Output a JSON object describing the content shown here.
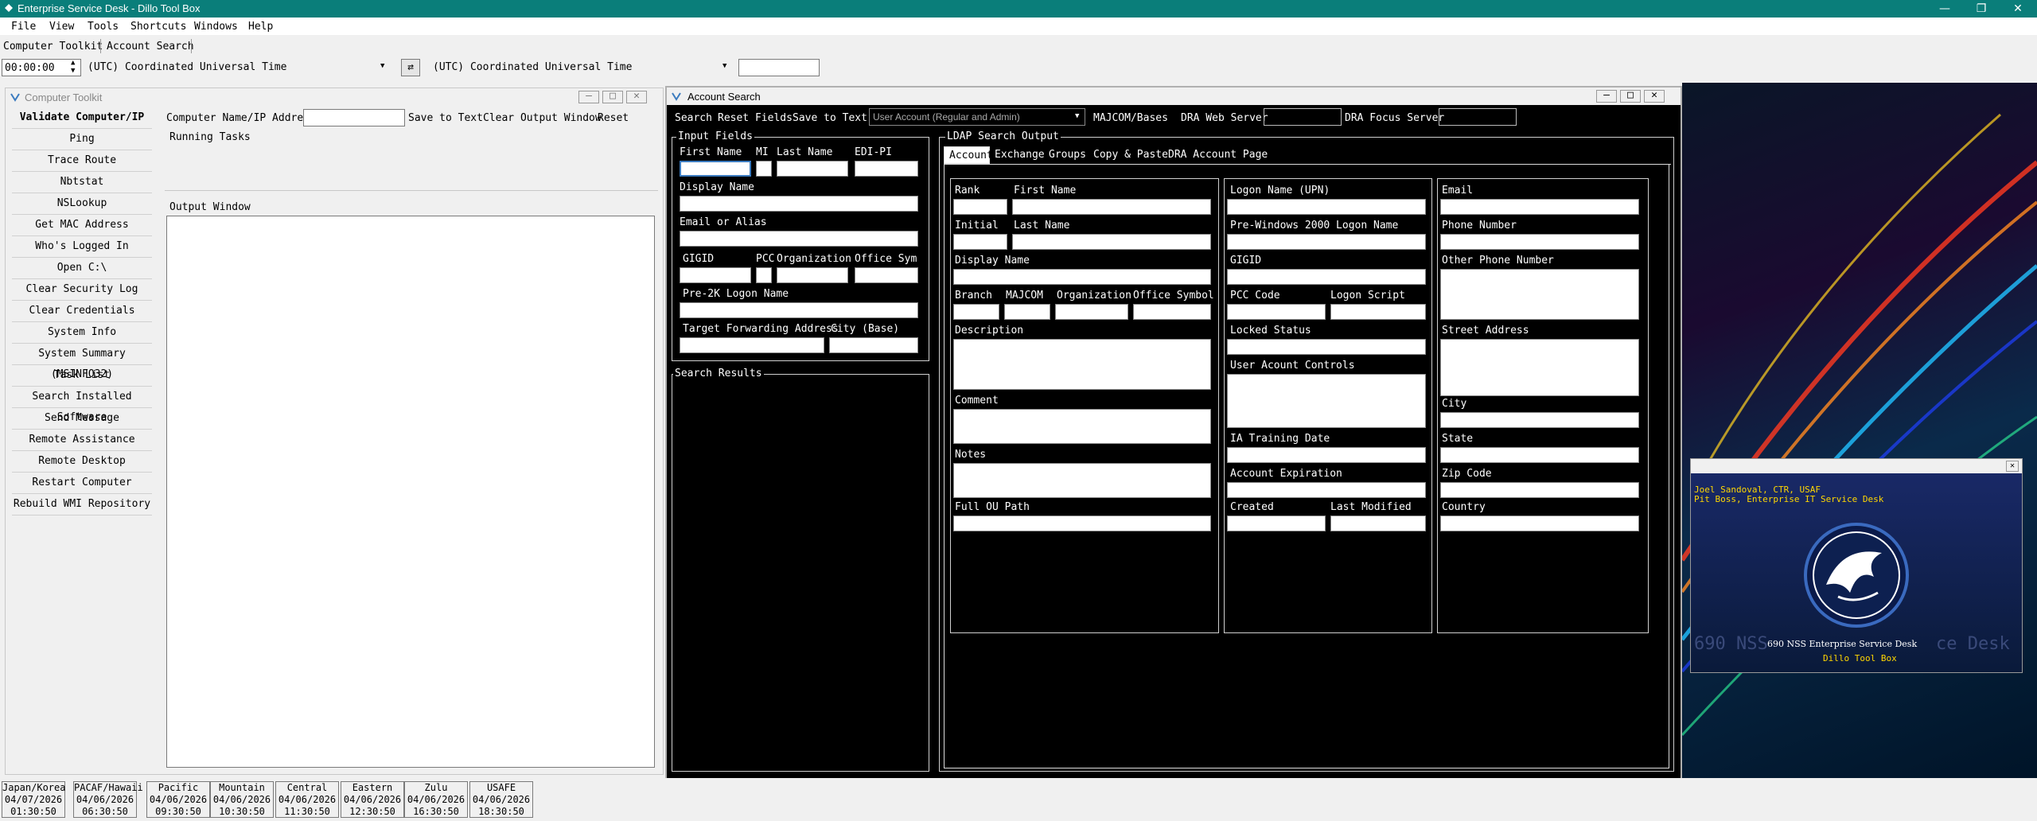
{
  "window": {
    "title": "Enterprise Service Desk - Dillo Tool Box"
  },
  "menu": [
    "File",
    "View",
    "Tools",
    "Shortcuts",
    "Windows",
    "Help"
  ],
  "toolbar": [
    "Computer Toolkit",
    "Account Search"
  ],
  "timezone": {
    "time": "00:00:00",
    "tz1": "(UTC) Coordinated Universal Time",
    "tz2": "(UTC) Coordinated Universal Time"
  },
  "computer_toolkit": {
    "title": "Computer Toolkit",
    "buttons": [
      "Validate Computer/IP",
      "Ping",
      "Trace Route",
      "Nbtstat",
      "NSLookup",
      "Get MAC Address",
      "Who's Logged In",
      "Open C:\\",
      "Clear Security Log",
      "Clear Credentials",
      "System Info",
      "System Summary (MSINFO32)",
      "Task List",
      "Search Installed Software",
      "Send Message",
      "Remote Assistance",
      "Remote Desktop",
      "Restart Computer",
      "Rebuild WMI Repository"
    ],
    "name_label": "Computer Name/IP Address",
    "save_text": "Save to Text",
    "clear_output": "Clear Output Window",
    "reset": "Reset",
    "running_tasks": "Running Tasks",
    "output_window": "Output Window"
  },
  "account_search": {
    "title": "Account Search",
    "toolbar": [
      "Search",
      "Reset Fields",
      "Save to Text"
    ],
    "account_type": "User Account (Regular and Admin)",
    "majcom": "MAJCOM/Bases",
    "dra_web": "DRA Web Server",
    "dra_focus": "DRA Focus Server",
    "input_fields": "Input Fields",
    "labels": {
      "first_name": "First Name",
      "mi": "MI",
      "last_name": "Last Name",
      "edipi": "EDI-PI",
      "display_name": "Display Name",
      "email_alias": "Email or Alias",
      "gigid": "GIGID",
      "pcc": "PCC",
      "organization": "Organization",
      "office_sym": "Office Sym",
      "pre2k": "Pre-2K Logon Name",
      "target_fwd": "Target Forwarding Address",
      "city_base": "City (Base)"
    },
    "search_results": "Search Results",
    "ldap_output": "LDAP Search Output",
    "tabs": [
      "Account",
      "Exchange",
      "Groups",
      "Copy & Paste",
      "DRA Account Page"
    ],
    "col1": {
      "rank": "Rank",
      "first_name": "First Name",
      "initial": "Initial",
      "last_name": "Last Name",
      "display_name": "Display Name",
      "branch": "Branch",
      "majcom": "MAJCOM",
      "organization": "Organization",
      "office_symbol": "Office Symbol",
      "description": "Description",
      "comment": "Comment",
      "notes": "Notes",
      "full_ou": "Full OU Path"
    },
    "col2": {
      "upn": "Logon Name (UPN)",
      "pre2000": "Pre-Windows 2000 Logon Name",
      "gigid": "GIGID",
      "pcc_code": "PCC Code",
      "logon_script": "Logon Script",
      "locked": "Locked Status",
      "uac": "User Acount Controls",
      "ia": "IA Training Date",
      "expiration": "Account Expiration",
      "created": "Created",
      "modified": "Last Modified"
    },
    "col3": {
      "email": "Email",
      "phone": "Phone Number",
      "other_phone": "Other Phone Number",
      "street": "Street Address",
      "city": "City",
      "state": "State",
      "zip": "Zip Code",
      "country": "Country"
    }
  },
  "profile": {
    "name": "Joel Sandoval, CTR, USAF",
    "role": "Pit Boss, Enterprise IT Service Desk",
    "org": "690 NSS Enterprise Service Desk",
    "app": "Dillo Tool Box",
    "bg_text": "690 NSS",
    "bg_text2": "ce Desk"
  },
  "clocks": [
    {
      "zone": "Japan/Korea",
      "date": "04/07/2026",
      "time": "01:30:50"
    },
    {
      "zone": "PACAF/Hawaii",
      "date": "04/06/2026",
      "time": "06:30:50"
    },
    {
      "zone": "Pacific",
      "date": "04/06/2026",
      "time": "09:30:50"
    },
    {
      "zone": "Mountain",
      "date": "04/06/2026",
      "time": "10:30:50"
    },
    {
      "zone": "Central",
      "date": "04/06/2026",
      "time": "11:30:50"
    },
    {
      "zone": "Eastern",
      "date": "04/06/2026",
      "time": "12:30:50"
    },
    {
      "zone": "Zulu",
      "date": "04/06/2026",
      "time": "16:30:50"
    },
    {
      "zone": "USAFE",
      "date": "04/06/2026",
      "time": "18:30:50"
    }
  ],
  "colors": {
    "titlebar": "#0a7e7a",
    "dark": "#000000",
    "profile_text": "#ffd700"
  }
}
